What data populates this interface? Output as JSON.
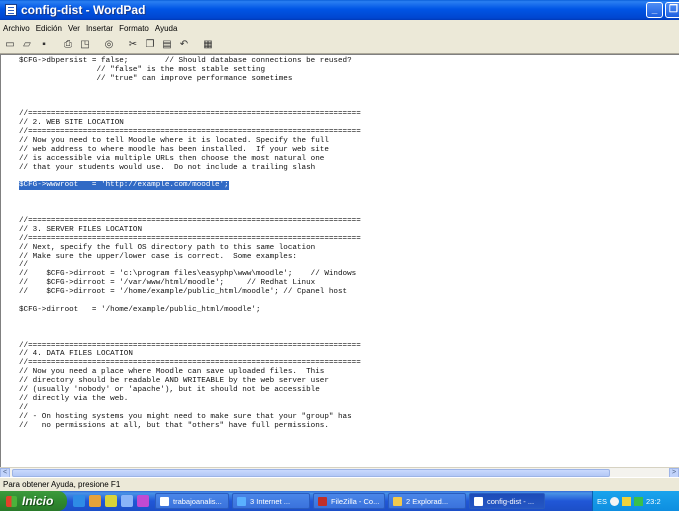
{
  "window": {
    "title": "config-dist - WordPad",
    "min_glyph": "_",
    "max_glyph": "❐"
  },
  "menu": [
    "Archivo",
    "Edición",
    "Ver",
    "Insertar",
    "Formato",
    "Ayuda"
  ],
  "toolbar_icons": [
    "new-icon",
    "open-icon",
    "save-icon",
    "print-icon",
    "print-preview-icon",
    "find-icon",
    "cut-icon",
    "copy-icon",
    "paste-icon",
    "undo-icon",
    "date-time-icon"
  ],
  "document": {
    "lines": [
      "$CFG->dbpersist = false;        // Should database connections be reused?",
      "                 // \"false\" is the most stable setting",
      "                 // \"true\" can improve performance sometimes",
      "",
      "",
      "",
      "//=========================================================================",
      "// 2. WEB SITE LOCATION",
      "//=========================================================================",
      "// Now you need to tell Moodle where it is located. Specify the full",
      "// web address to where moodle has been installed.  If your web site",
      "// is accessible via multiple URLs then choose the most natural one",
      "// that your students would use.  Do not include a trailing slash",
      "",
      "$CFG->wwwroot   = 'http://example.com/moodle';",
      "",
      "",
      "",
      "//=========================================================================",
      "// 3. SERVER FILES LOCATION",
      "//=========================================================================",
      "// Next, specify the full OS directory path to this same location",
      "// Make sure the upper/lower case is correct.  Some examples:",
      "//",
      "//    $CFG->dirroot = 'c:\\program files\\easyphp\\www\\moodle';    // Windows",
      "//    $CFG->dirroot = '/var/www/html/moodle';     // Redhat Linux",
      "//    $CFG->dirroot = '/home/example/public_html/moodle'; // Cpanel host",
      "",
      "$CFG->dirroot   = '/home/example/public_html/moodle';",
      "",
      "",
      "",
      "//=========================================================================",
      "// 4. DATA FILES LOCATION",
      "//=========================================================================",
      "// Now you need a place where Moodle can save uploaded files.  This",
      "// directory should be readable AND WRITEABLE by the web server user",
      "// (usually 'nobody' or 'apache'), but it should not be accessible",
      "// directly via the web.",
      "//",
      "// - On hosting systems you might need to make sure that your \"group\" has",
      "//   no permissions at all, but that \"others\" have full permissions."
    ],
    "selected_line": 14
  },
  "scrollbar": {
    "left_glyph": "<",
    "right_glyph": ">"
  },
  "status": "Para obtener Ayuda, presione F1",
  "taskbar": {
    "start_label": "Inicio",
    "tasks": [
      {
        "label": "trabajoanalis...",
        "active": false
      },
      {
        "label": "3 Internet ...",
        "active": false
      },
      {
        "label": "FileZilla - Co...",
        "active": false
      },
      {
        "label": "2 Explorad...",
        "active": false
      },
      {
        "label": "config-dist - ...",
        "active": true
      }
    ],
    "lang": "ES",
    "clock": "23:2"
  }
}
